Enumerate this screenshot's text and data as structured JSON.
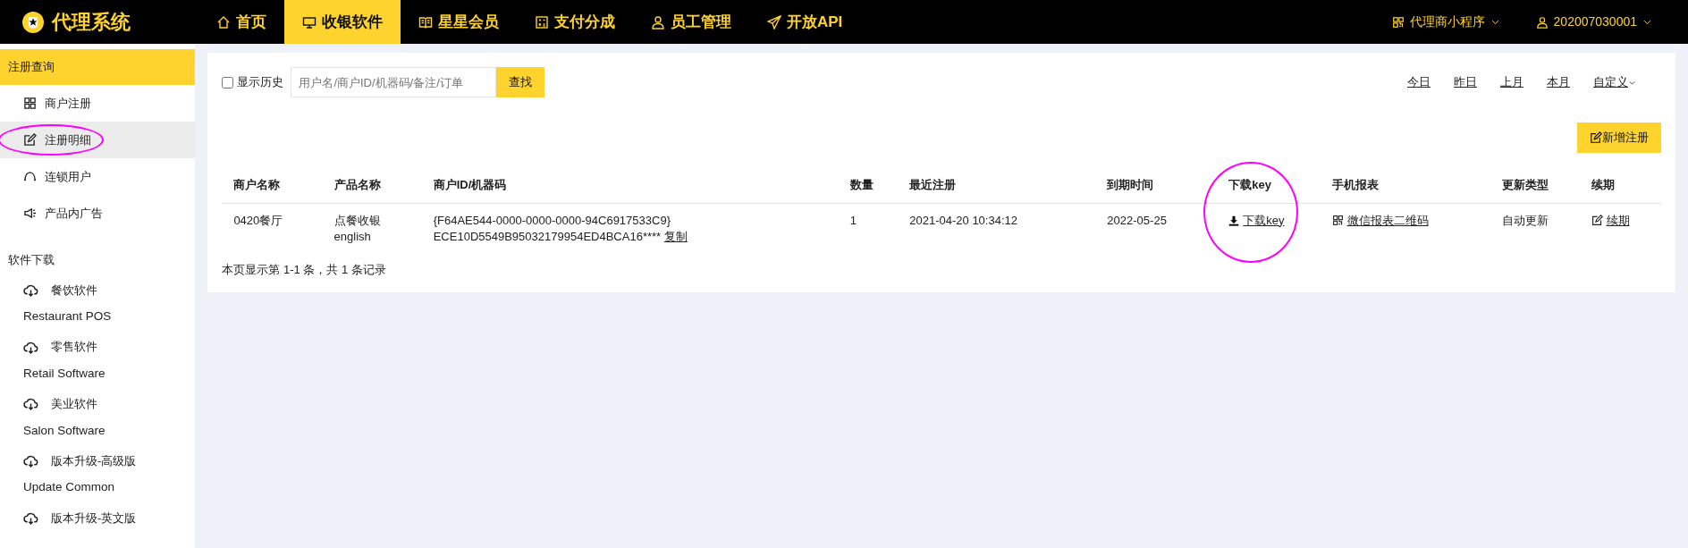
{
  "app": {
    "title": "代理系统"
  },
  "nav": [
    {
      "label": "首页",
      "selected": false
    },
    {
      "label": "收银软件",
      "selected": true
    },
    {
      "label": "星星会员",
      "selected": false
    },
    {
      "label": "支付分成",
      "selected": false
    },
    {
      "label": "员工管理",
      "selected": false
    },
    {
      "label": "开放API",
      "selected": false
    }
  ],
  "top_right": [
    {
      "label": "代理商小程序"
    },
    {
      "label": "202007030001"
    }
  ],
  "sidebar": {
    "group_title": "注册查询",
    "items": [
      {
        "label": "商户注册",
        "selected": false,
        "circled": false
      },
      {
        "label": "注册明细",
        "selected": true,
        "circled": true
      },
      {
        "label": "连锁用户",
        "selected": false,
        "circled": false
      },
      {
        "label": "产品内广告",
        "selected": false,
        "circled": false
      }
    ],
    "downloads_title": "软件下载",
    "downloads": [
      {
        "label": "餐饮软件",
        "subtitle": "Restaurant POS"
      },
      {
        "label": "零售软件",
        "subtitle": "Retail Software"
      },
      {
        "label": "美业软件",
        "subtitle": "Salon Software"
      },
      {
        "label": "版本升级-高级版",
        "subtitle": "Update Common"
      },
      {
        "label": "版本升级-英文版"
      }
    ]
  },
  "filter": {
    "show_history": {
      "label": "显示历史",
      "checked": false
    },
    "search": {
      "placeholder": "用户名/商户ID/机器码/备注/订单"
    },
    "search_button": "查找",
    "date_links": [
      "今日",
      "昨日",
      "上月",
      "本月",
      "自定义"
    ]
  },
  "new_button": "新增注册",
  "table": {
    "columns": [
      {
        "label": "商户名称",
        "circled": false
      },
      {
        "label": "产品名称",
        "circled": false
      },
      {
        "label": "商户ID/机器码",
        "circled": false
      },
      {
        "label": "数量",
        "circled": false
      },
      {
        "label": "最近注册",
        "circled": false
      },
      {
        "label": "到期时间",
        "circled": false
      },
      {
        "label": "下载key",
        "circled": true
      },
      {
        "label": "手机报表",
        "circled": false
      },
      {
        "label": "更新类型",
        "circled": false
      },
      {
        "label": "续期",
        "circled": false
      }
    ],
    "rows": [
      {
        "cells": [
          {
            "kind": "text",
            "text": "0420餐厅"
          },
          {
            "kind": "lines",
            "lines": [
              "点餐收银",
              "english"
            ]
          },
          {
            "kind": "machine",
            "lines": [
              "{F64AE544-0000-0000-0000-94C6917533C9}",
              "ECE10D5549B95032179954ED4BCA16****"
            ],
            "link": "复制"
          },
          {
            "kind": "text",
            "text": "1"
          },
          {
            "kind": "text",
            "text": "2021-04-20 10:34:12"
          },
          {
            "kind": "text",
            "text": "2022-05-25"
          },
          {
            "kind": "download",
            "text": "下载key"
          },
          {
            "kind": "report",
            "text": "微信报表二维码"
          },
          {
            "kind": "text",
            "text": "自动更新"
          },
          {
            "kind": "renew",
            "text": "续期"
          }
        ]
      }
    ]
  },
  "footer": "本页显示第 1-1 条，共 1 条记录"
}
